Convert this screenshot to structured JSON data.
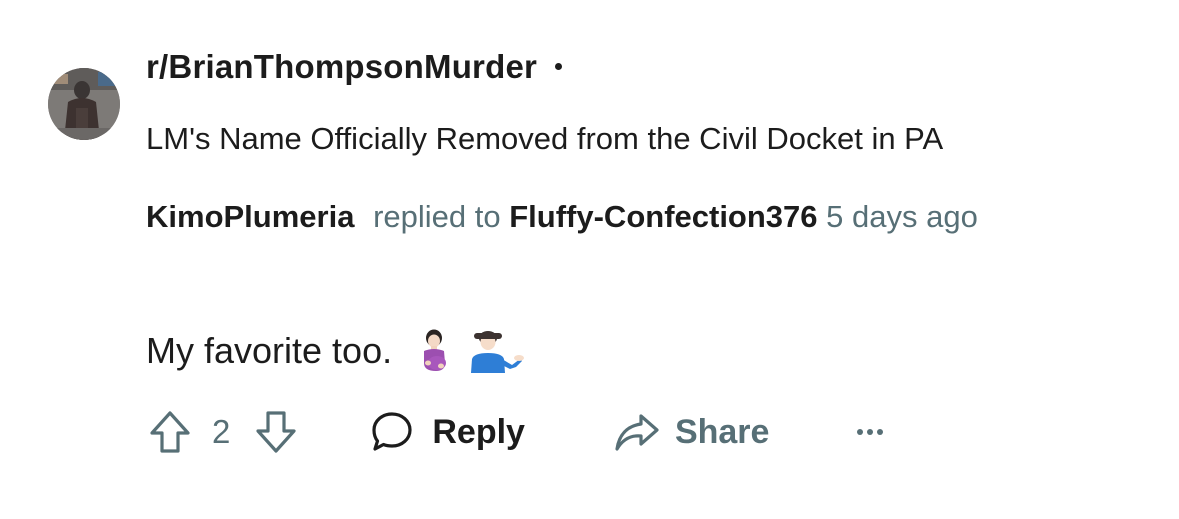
{
  "subreddit": "r/BrianThompsonMurder",
  "post_title": "LM's Name Officially Removed from the Civil Docket in PA",
  "comment": {
    "author": "KimoPlumeria",
    "reply_phrase": "replied to",
    "reply_to": "Fluffy-Confection376",
    "time": "5 days ago",
    "body": "My favorite too.",
    "emojis": [
      "pregnant-woman-emoji",
      "man-tipping-hand-emoji"
    ]
  },
  "actions": {
    "score": "2",
    "reply_label": "Reply",
    "share_label": "Share"
  },
  "icons": [
    "upvote-icon",
    "downvote-icon",
    "comment-icon",
    "share-icon",
    "more-icon"
  ],
  "colors": {
    "text_primary": "#1c1c1c",
    "text_secondary": "#576f76",
    "background": "#ffffff"
  }
}
